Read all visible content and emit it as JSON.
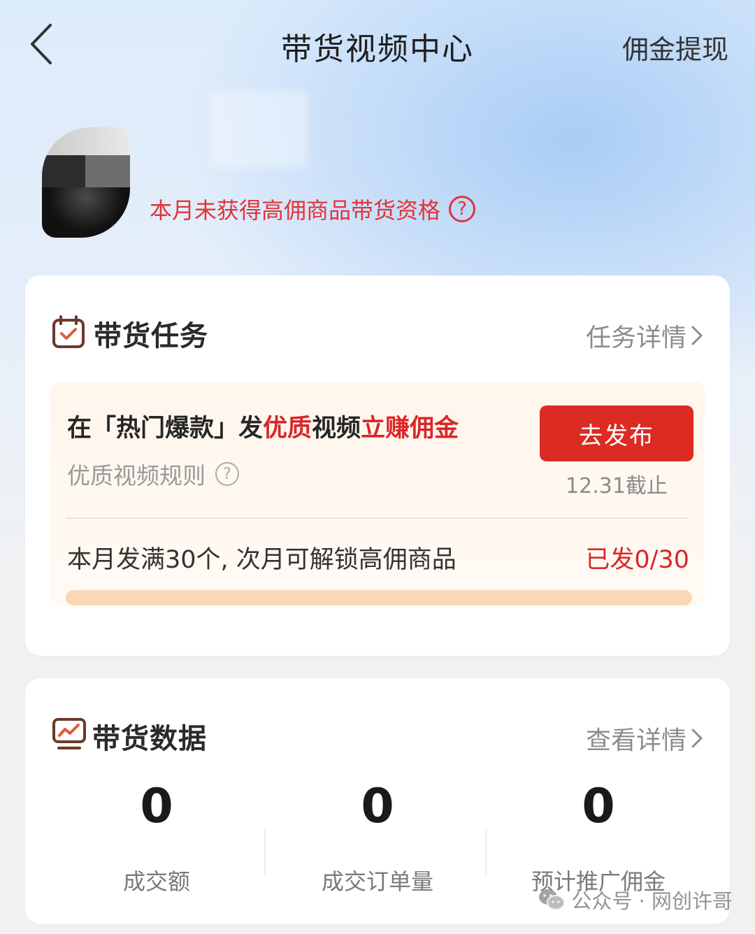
{
  "header": {
    "title": "带货视频中心",
    "withdraw_label": "佣金提现"
  },
  "profile": {
    "warning_text": "本月未获得高佣商品带货资格",
    "help_mark": "?"
  },
  "task_card": {
    "title": "带货任务",
    "detail_link": "任务详情",
    "headline_prefix": "在「热门爆款」发",
    "headline_hl1": "优质",
    "headline_mid": "视频",
    "headline_hl2": "立赚佣金",
    "rules_label": "优质视频规则",
    "rules_help": "?",
    "publish_button": "去发布",
    "deadline": "12.31截止",
    "progress_text": "本月发满30个, 次月可解锁高佣商品",
    "progress_count": "已发0/30",
    "progress_fraction": 0
  },
  "data_card": {
    "title": "带货数据",
    "detail_link": "查看详情",
    "stats": [
      {
        "value": "0",
        "label": "成交额"
      },
      {
        "value": "0",
        "label": "成交订单量"
      },
      {
        "value": "0",
        "label": "预计推广佣金"
      }
    ]
  },
  "watermark": {
    "text": "公众号 · 网创许哥",
    "icon": "wechat-icon"
  },
  "colors": {
    "accent_red": "#dc2b22",
    "warning_red": "#e1343a",
    "progress_track": "#fbd7b6",
    "task_box_bg": "#fff6ec"
  }
}
